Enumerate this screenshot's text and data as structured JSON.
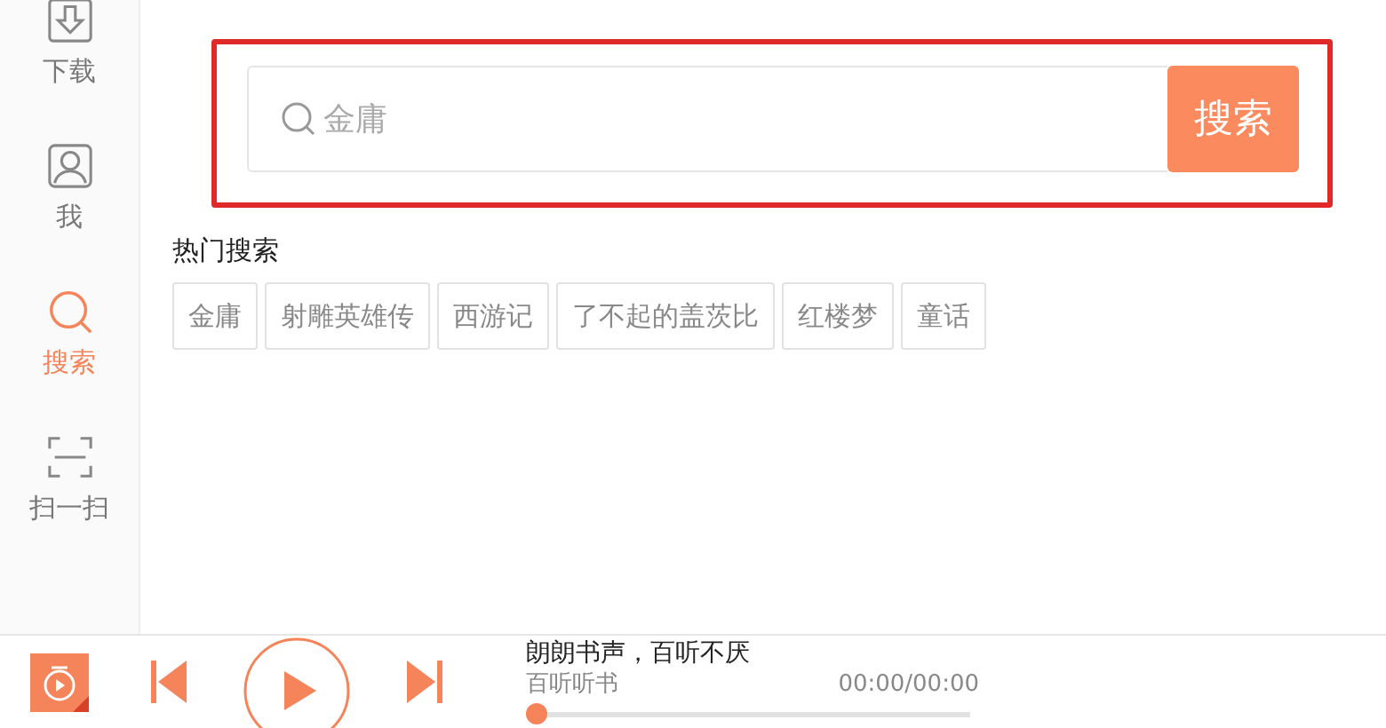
{
  "sidebar": {
    "items": [
      {
        "kind": "download",
        "label": "下载",
        "selected": false
      },
      {
        "kind": "profile",
        "label": "我",
        "selected": false
      },
      {
        "kind": "search",
        "label": "搜索",
        "selected": true
      },
      {
        "kind": "scan",
        "label": "扫一扫",
        "selected": false
      }
    ]
  },
  "search": {
    "placeholder": "金庸",
    "button": "搜索"
  },
  "hot_searches": {
    "title": "热门搜索",
    "tags": [
      "金庸",
      "射雕英雄传",
      "西游记",
      "了不起的盖茨比",
      "红楼梦",
      "童话"
    ]
  },
  "player": {
    "title": "朗朗书声，百听不厌",
    "album": "百听听书",
    "time": "00:00/00:00",
    "level": 0
  }
}
